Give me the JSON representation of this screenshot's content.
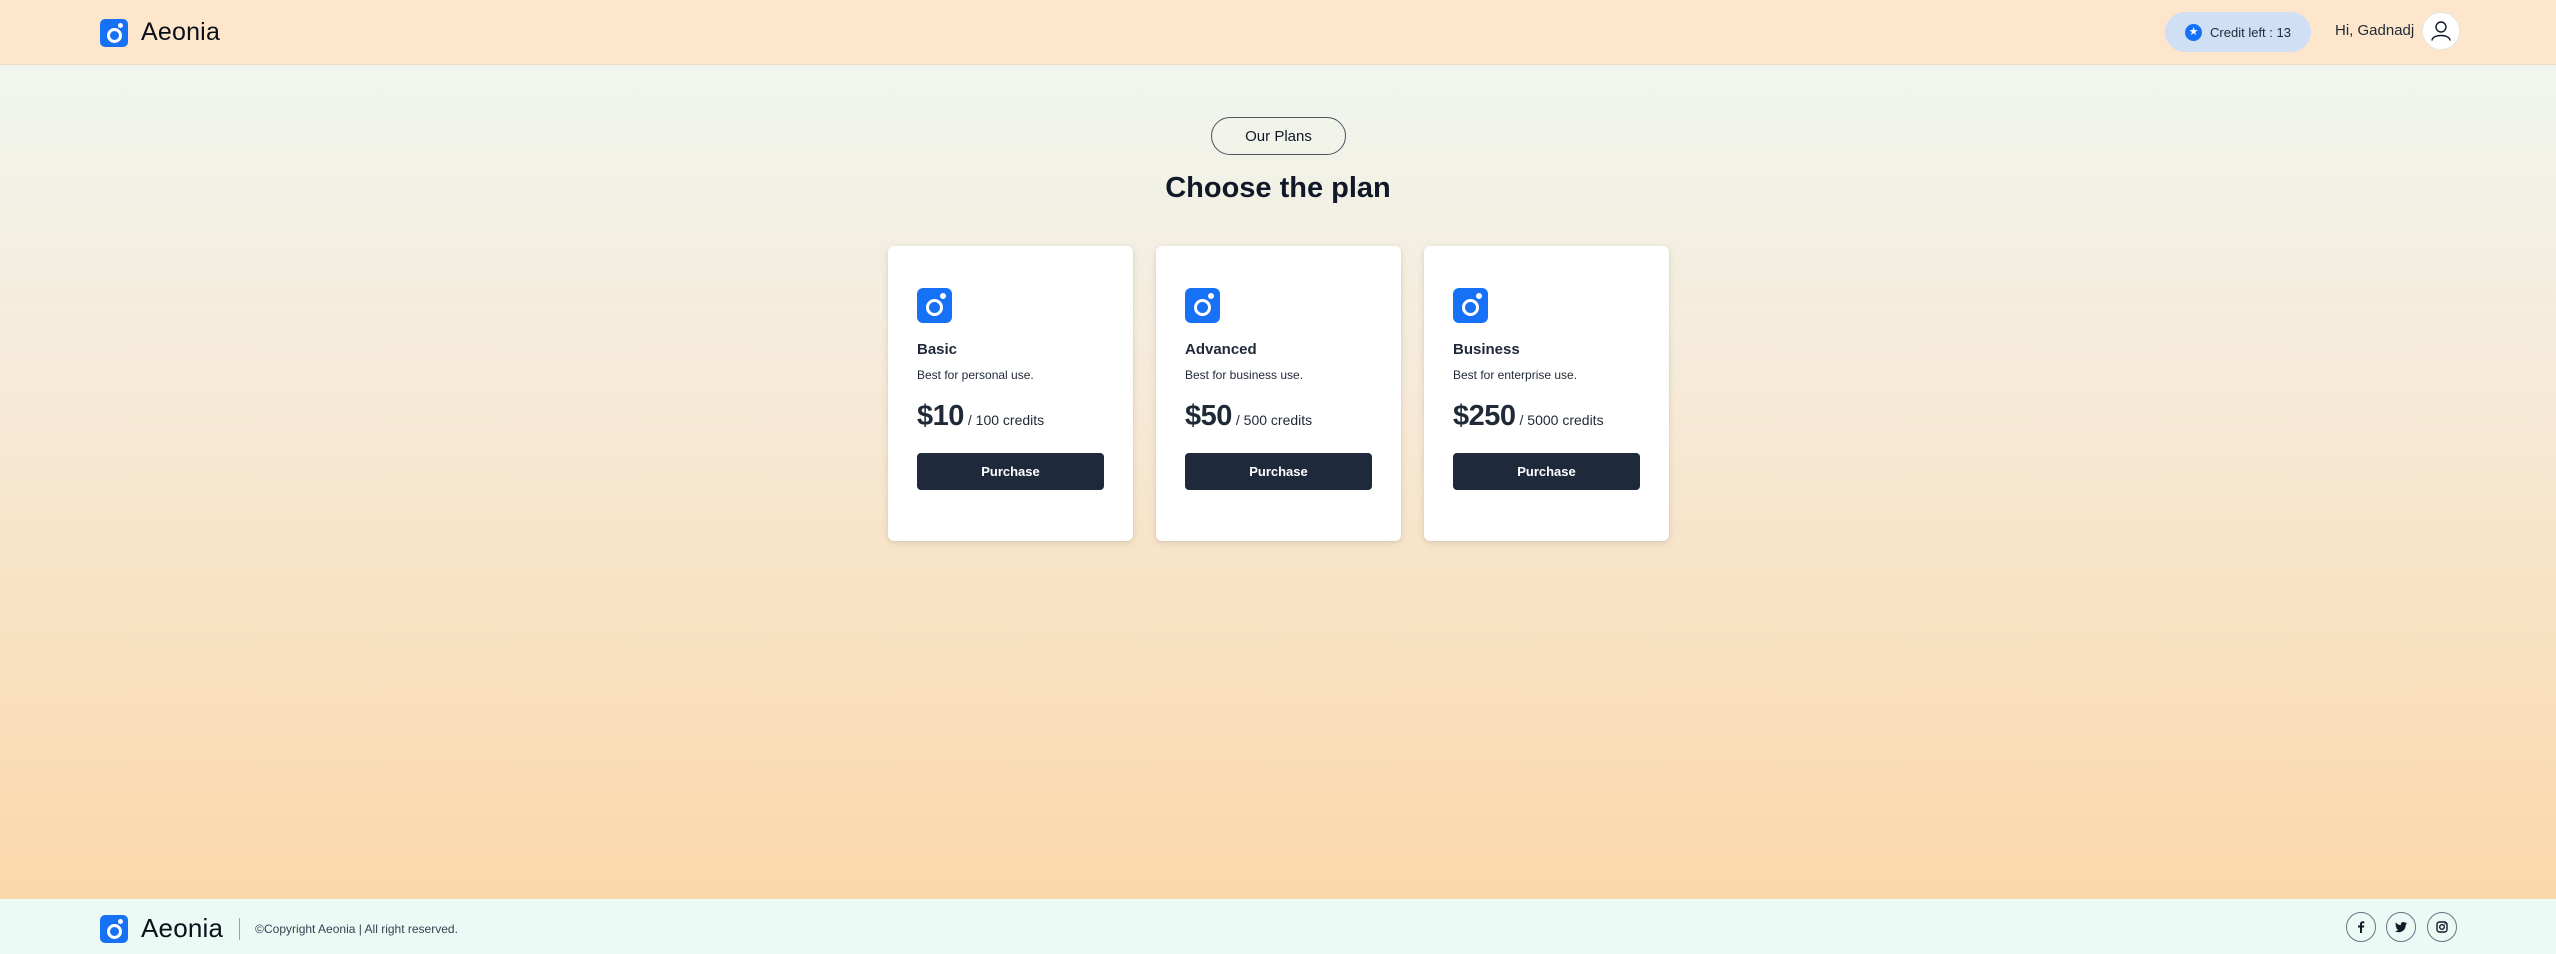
{
  "header": {
    "brand": "Aeonia",
    "credit_label": "Credit left : 13",
    "greeting": "Hi, Gadnadj",
    "icons": {
      "logo": "aeonia-logo-icon",
      "credit": "star-icon",
      "avatar": "user-icon"
    }
  },
  "main": {
    "section_label": "Our Plans",
    "title": "Choose the plan",
    "plans": [
      {
        "name": "Basic",
        "description": "Best for personal use.",
        "price": "$10",
        "unit": "/ 100 credits",
        "button": "Purchase"
      },
      {
        "name": "Advanced",
        "description": "Best for business use.",
        "price": "$50",
        "unit": "/ 500 credits",
        "button": "Purchase"
      },
      {
        "name": "Business",
        "description": "Best for enterprise use.",
        "price": "$250",
        "unit": "/ 5000 credits",
        "button": "Purchase"
      }
    ]
  },
  "footer": {
    "brand": "Aeonia",
    "copyright": "©Copyright Aeonia | All right reserved.",
    "social": [
      "facebook-icon",
      "twitter-icon",
      "instagram-icon"
    ]
  },
  "colors": {
    "accent": "#1671f6",
    "button": "#1e293b",
    "header_bg": "#fde6cb",
    "footer_bg": "#ecfaf6",
    "credit_pill_bg": "#cfe0f5"
  }
}
